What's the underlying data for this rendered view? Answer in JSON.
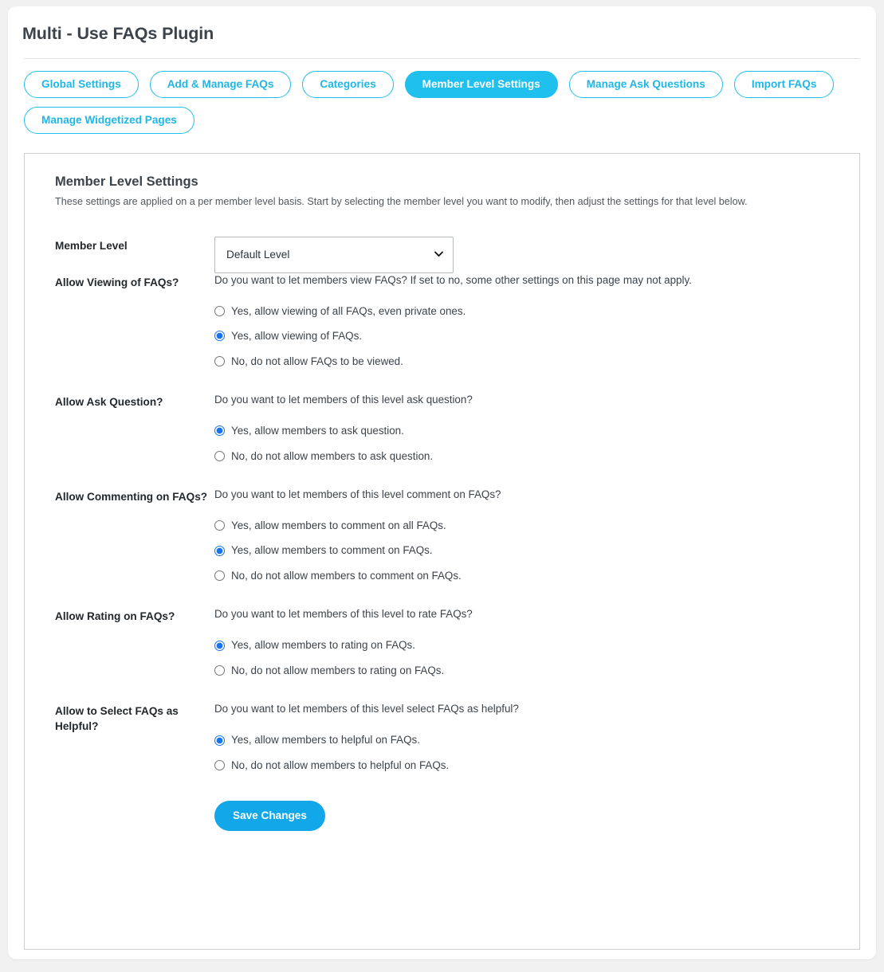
{
  "app": {
    "title": "Multi - Use FAQs Plugin"
  },
  "colors": {
    "accent_tab": "#1fc0ee",
    "accent_button": "#11a7e8",
    "page_background": "#f1f1f1",
    "card_background": "#ffffff",
    "label_text": "#23282d",
    "body_text": "#3c434a",
    "radio_selected": "#1a73e8"
  },
  "tabs": [
    {
      "label": "Global Settings",
      "active": false
    },
    {
      "label": "Add & Manage FAQs",
      "active": false
    },
    {
      "label": "Categories",
      "active": false
    },
    {
      "label": "Member Level Settings",
      "active": true
    },
    {
      "label": "Manage Ask Questions",
      "active": false
    },
    {
      "label": "Import FAQs",
      "active": false
    },
    {
      "label": "Manage Widgetized Pages",
      "active": false
    }
  ],
  "panel": {
    "heading": "Member Level Settings",
    "description": "These settings are applied on a per member level basis. Start by selecting the member level you want to modify, then adjust the settings for that level below."
  },
  "member_level": {
    "label": "Member Level",
    "selected": "Default Level",
    "options": [
      "Default Level"
    ],
    "arrow_icon": "chevron-down-icon"
  },
  "settings": [
    {
      "label": "Allow Viewing of FAQs?",
      "description": "Do you want to let members view FAQs? If set to no, some other settings on this page may not apply.",
      "options": [
        {
          "text": "Yes, allow viewing of all FAQs, even private ones.",
          "checked": false
        },
        {
          "text": "Yes, allow viewing of FAQs.",
          "checked": true
        },
        {
          "text": "No, do not allow FAQs to be viewed.",
          "checked": false
        }
      ]
    },
    {
      "label": "Allow Ask Question?",
      "description": "Do you want to let members of this level ask question?",
      "options": [
        {
          "text": "Yes, allow members to ask question.",
          "checked": true
        },
        {
          "text": "No, do not allow members to ask question.",
          "checked": false
        }
      ]
    },
    {
      "label": "Allow Commenting on FAQs?",
      "description": "Do you want to let members of this level comment on FAQs?",
      "options": [
        {
          "text": "Yes, allow members to comment on all FAQs.",
          "checked": false
        },
        {
          "text": "Yes, allow members to comment on FAQs.",
          "checked": true
        },
        {
          "text": "No, do not allow members to comment on FAQs.",
          "checked": false
        }
      ]
    },
    {
      "label": "Allow Rating on FAQs?",
      "description": "Do you want to let members of this level to rate FAQs?",
      "options": [
        {
          "text": "Yes, allow members to rating on FAQs.",
          "checked": true
        },
        {
          "text": "No, do not allow members to rating on FAQs.",
          "checked": false
        }
      ]
    },
    {
      "label": "Allow to Select FAQs as Helpful?",
      "description": "Do you want to let members of this level select FAQs as helpful?",
      "options": [
        {
          "text": "Yes, allow members to helpful on FAQs.",
          "checked": true
        },
        {
          "text": "No, do not allow members to helpful on FAQs.",
          "checked": false
        }
      ]
    }
  ],
  "actions": {
    "save_label": "Save Changes"
  }
}
